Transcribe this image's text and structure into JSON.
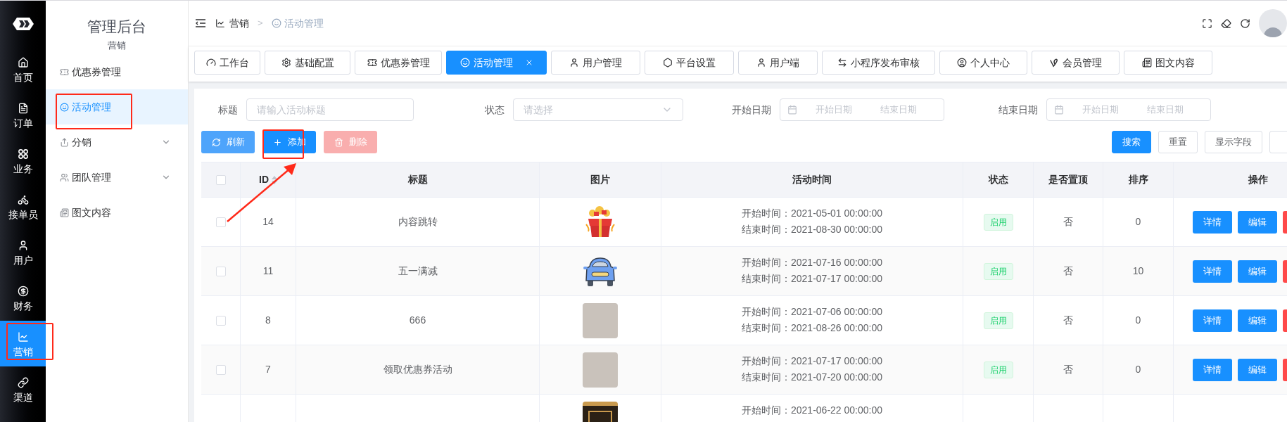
{
  "rail": {
    "items": [
      {
        "label": "首页",
        "selected": false
      },
      {
        "label": "订单",
        "selected": false
      },
      {
        "label": "业务",
        "selected": false
      },
      {
        "label": "接单员",
        "selected": false
      },
      {
        "label": "用户",
        "selected": false
      },
      {
        "label": "财务",
        "selected": false
      },
      {
        "label": "营销",
        "selected": true
      },
      {
        "label": "渠道",
        "selected": false
      }
    ]
  },
  "sidebar": {
    "title": "管理后台",
    "section": "营销",
    "items": [
      {
        "label": "优惠券管理",
        "selected": false,
        "kind": "link"
      },
      {
        "label": "活动管理",
        "selected": true,
        "kind": "link"
      },
      {
        "label": "分销",
        "selected": false,
        "kind": "group"
      },
      {
        "label": "团队管理",
        "selected": false,
        "kind": "group"
      },
      {
        "label": "图文内容",
        "selected": false,
        "kind": "link"
      }
    ]
  },
  "breadcrumb": {
    "items": [
      "营销",
      "活动管理"
    ],
    "separator": ">"
  },
  "tabs": [
    {
      "label": "工作台",
      "selected": false
    },
    {
      "label": "基础配置",
      "selected": false
    },
    {
      "label": "优惠券管理",
      "selected": false
    },
    {
      "label": "活动管理",
      "selected": true
    },
    {
      "label": "用户管理",
      "selected": false
    },
    {
      "label": "平台设置",
      "selected": false
    },
    {
      "label": "用户端",
      "selected": false
    },
    {
      "label": "小程序发布审核",
      "selected": false
    },
    {
      "label": "个人中心",
      "selected": false
    },
    {
      "label": "会员管理",
      "selected": false
    },
    {
      "label": "图文内容",
      "selected": false
    }
  ],
  "filters": [
    {
      "label": "标题",
      "kind": "text",
      "placeholder": "请输入活动标题"
    },
    {
      "label": "状态",
      "kind": "select",
      "placeholder": "请选择"
    },
    {
      "label": "开始日期",
      "kind": "daterange",
      "placeholder": "开始日期",
      "placeholder_end": "结束日期"
    },
    {
      "label": "结束日期",
      "kind": "daterange",
      "placeholder": "开始日期",
      "placeholder_end": "结束日期"
    }
  ],
  "toolbar": {
    "left": [
      {
        "label": "刷新",
        "kind": "refresh",
        "disabled": false
      },
      {
        "label": "添加",
        "kind": "add",
        "disabled": false
      },
      {
        "label": "删除",
        "kind": "delete",
        "disabled": true
      }
    ],
    "right": [
      {
        "label": "搜索",
        "kind": "primary"
      },
      {
        "label": "重置",
        "kind": "plain"
      },
      {
        "label": "显示字段",
        "kind": "plain"
      },
      {
        "kind": "plain"
      }
    ]
  },
  "table": {
    "select_all": {
      "checked": false
    },
    "columns": [
      "ID",
      "标题",
      "图片",
      "活动时间",
      "状态",
      "是否置顶",
      "排序",
      "操作"
    ],
    "rows": [
      {
        "checked": false,
        "id": "14",
        "title": "内容跳转",
        "kind": "gift",
        "start": "开始时间：2021-05-01 00:00:00",
        "end": "结束时间：2021-08-30 00:00:00",
        "status": "启用",
        "pinned": "否",
        "sort": "0",
        "actions": [
          "详情",
          "编辑"
        ]
      },
      {
        "checked": false,
        "id": "11",
        "title": "五一满减",
        "kind": "car",
        "start": "开始时间：2021-07-16 00:00:00",
        "end": "结束时间：2021-07-17 00:00:00",
        "status": "启用",
        "pinned": "否",
        "sort": "10",
        "actions": [
          "详情",
          "编辑"
        ]
      },
      {
        "checked": false,
        "id": "8",
        "title": "666",
        "kind": "photo",
        "start": "开始时间：2021-07-06 00:00:00",
        "end": "结束时间：2021-08-26 00:00:00",
        "status": "启用",
        "pinned": "否",
        "sort": "0",
        "actions": [
          "详情",
          "编辑"
        ]
      },
      {
        "checked": false,
        "id": "7",
        "title": "领取优惠券活动",
        "kind": "photo",
        "start": "开始时间：2021-07-17 00:00:00",
        "end": "结束时间：2021-07-20 00:00:00",
        "status": "启用",
        "pinned": "否",
        "sort": "0",
        "actions": [
          "详情",
          "编辑"
        ]
      },
      {
        "kind": "frame",
        "start": "开始时间：2021-06-22 00:00:00"
      }
    ]
  }
}
